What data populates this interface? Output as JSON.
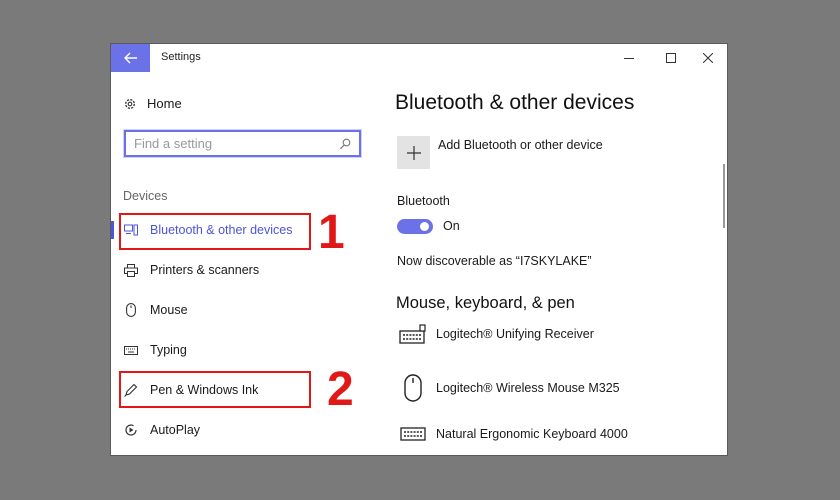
{
  "window": {
    "title": "Settings",
    "controls": [
      "minimize",
      "maximize",
      "close"
    ]
  },
  "sidebar": {
    "home_label": "Home",
    "search_placeholder": "Find a setting",
    "section_label": "Devices",
    "items": [
      {
        "label": "Bluetooth & other devices",
        "icon": "bluetooth-devices-icon",
        "active": true
      },
      {
        "label": "Printers & scanners",
        "icon": "printer-icon",
        "active": false
      },
      {
        "label": "Mouse",
        "icon": "mouse-icon",
        "active": false
      },
      {
        "label": "Typing",
        "icon": "keyboard-icon",
        "active": false
      },
      {
        "label": "Pen & Windows Ink",
        "icon": "pen-icon",
        "active": false
      },
      {
        "label": "AutoPlay",
        "icon": "autoplay-icon",
        "active": false
      }
    ]
  },
  "main": {
    "title": "Bluetooth & other devices",
    "add_device_label": "Add Bluetooth or other device",
    "bluetooth_label": "Bluetooth",
    "bluetooth_state": "On",
    "bluetooth_enabled": true,
    "discoverable_text": "Now discoverable as “I7SKYLAKE”",
    "section_title": "Mouse, keyboard, & pen",
    "devices": [
      {
        "name": "Logitech® Unifying Receiver",
        "icon": "keyboard-icon"
      },
      {
        "name": "Logitech® Wireless Mouse M325",
        "icon": "mouse-icon"
      },
      {
        "name": "Natural Ergonomic Keyboard 4000",
        "icon": "keyboard-icon"
      }
    ]
  },
  "annotations": {
    "step1": "1",
    "step2": "2",
    "color": "#e01818"
  },
  "colors": {
    "accent": "#4c55d6",
    "back_button": "#6b72e8"
  }
}
